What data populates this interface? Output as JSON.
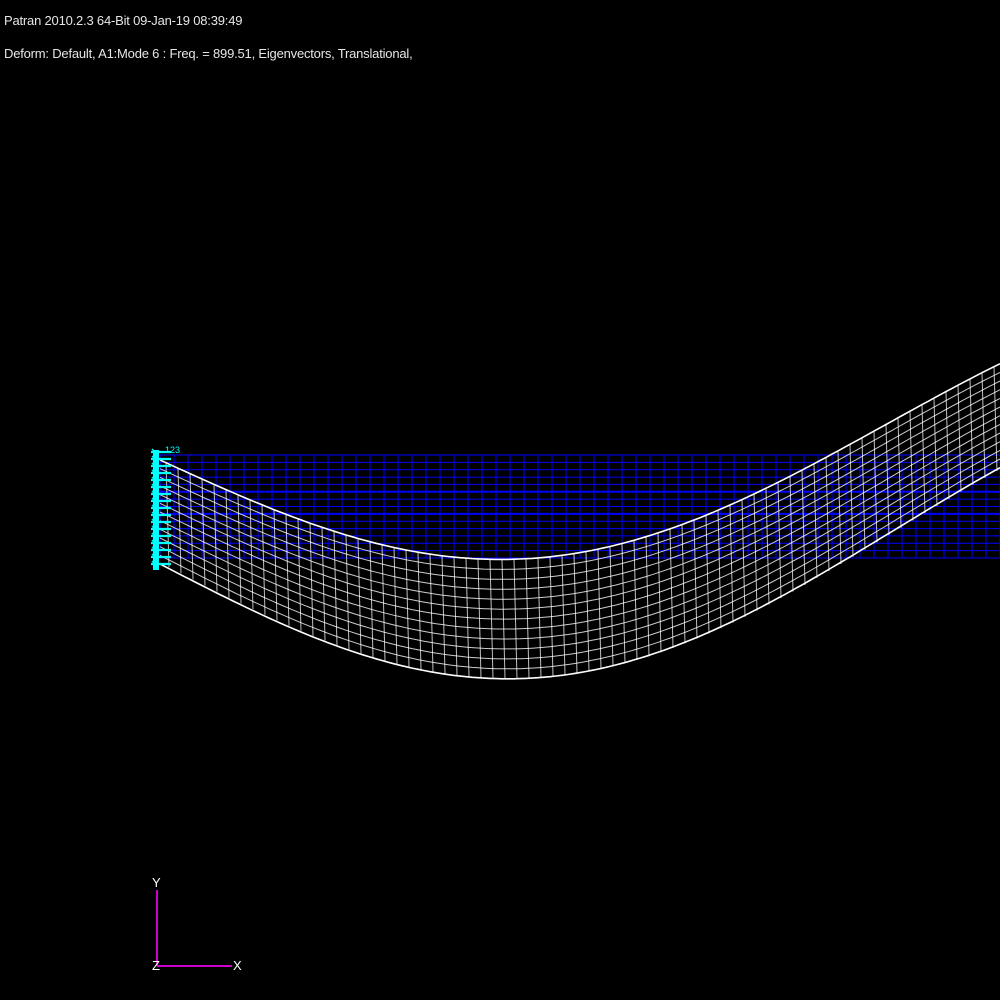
{
  "header": {
    "title": "Patran 2010.2.3 64-Bit 09-Jan-19 08:39:49",
    "subtitle": "Deform: Default, A1:Mode 6 : Freq. = 899.51, Eigenvectors, Translational,"
  },
  "triad": {
    "y_label": "Y",
    "z_label": "Z",
    "x_label": "X"
  },
  "constraint": {
    "label": "123"
  },
  "colors": {
    "background": "#000000",
    "undeformed_mesh": "#0000ff",
    "deformed_mesh": "#ffffff",
    "constraint": "#00ffff",
    "triad_axis": "#cc00cc"
  }
}
